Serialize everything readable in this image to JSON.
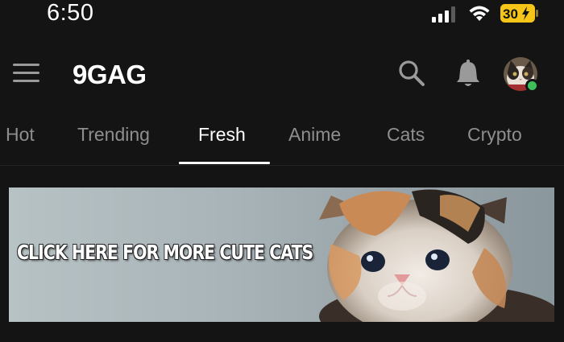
{
  "status_bar": {
    "time": "6:50",
    "battery_level": "30"
  },
  "header": {
    "logo": "9GAG"
  },
  "tabs": [
    {
      "label": "Hot",
      "active": false
    },
    {
      "label": "Trending",
      "active": false
    },
    {
      "label": "Fresh",
      "active": true
    },
    {
      "label": "Anime",
      "active": false
    },
    {
      "label": "Cats",
      "active": false
    },
    {
      "label": "Crypto",
      "active": false
    }
  ],
  "banner": {
    "text": "CLICK HERE FOR MORE CUTE CATS"
  },
  "colors": {
    "background": "#141414",
    "active_tab": "#ffffff",
    "inactive_tab": "#8e8e8e",
    "battery": "#f5c518",
    "online": "#3fbf5a"
  },
  "icons": [
    "signal-icon",
    "wifi-icon",
    "battery-icon",
    "menu-icon",
    "search-icon",
    "bell-icon"
  ]
}
